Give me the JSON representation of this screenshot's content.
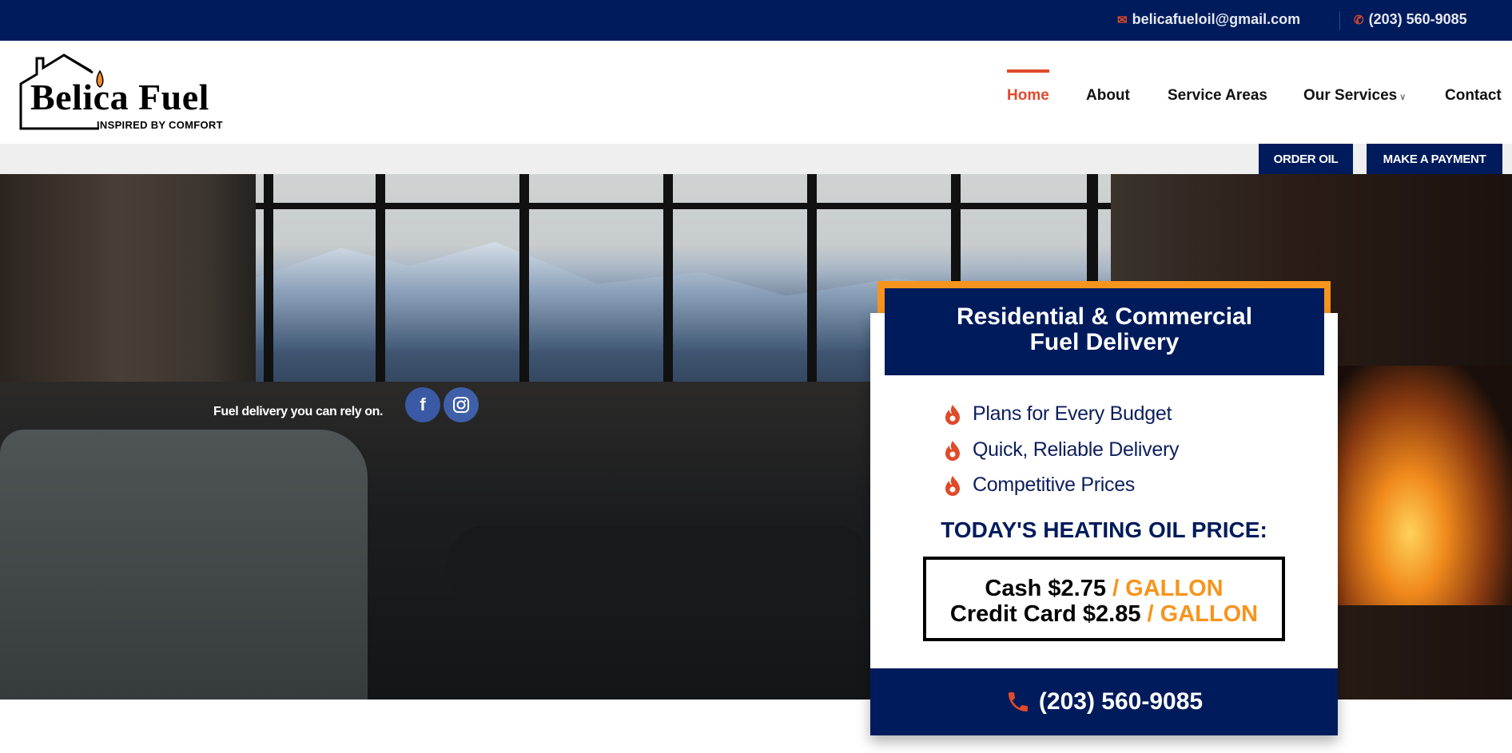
{
  "topbar": {
    "email": "belicafueloil@gmail.com",
    "phone": "(203) 560-9085"
  },
  "logo": {
    "name": "Belica Fuel",
    "tagline": "INSPIRED BY COMFORT"
  },
  "nav": {
    "items": [
      {
        "label": "Home",
        "active": true
      },
      {
        "label": "About"
      },
      {
        "label": "Service Areas"
      },
      {
        "label": "Our Services"
      },
      {
        "label": "Contact"
      }
    ]
  },
  "actions": {
    "order_oil": "ORDER OIL",
    "make_payment": "MAKE A PAYMENT"
  },
  "hero": {
    "tagline": "Fuel delivery you can rely on."
  },
  "card": {
    "title_line1": "Residential & Commercial",
    "title_line2": "Fuel Delivery",
    "bullets": [
      "Plans for Every Budget",
      "Quick, Reliable Delivery",
      "Competitive Prices"
    ],
    "price_title": "TODAY'S HEATING OIL PRICE:",
    "cash_label": "Cash $2.75",
    "credit_label": "Credit Card $2.85",
    "unit": "/ GALLON",
    "phone": "(203) 560-9085"
  },
  "colors": {
    "navy": "#001b5c",
    "orange": "#f7941d",
    "red": "#e0492a"
  }
}
